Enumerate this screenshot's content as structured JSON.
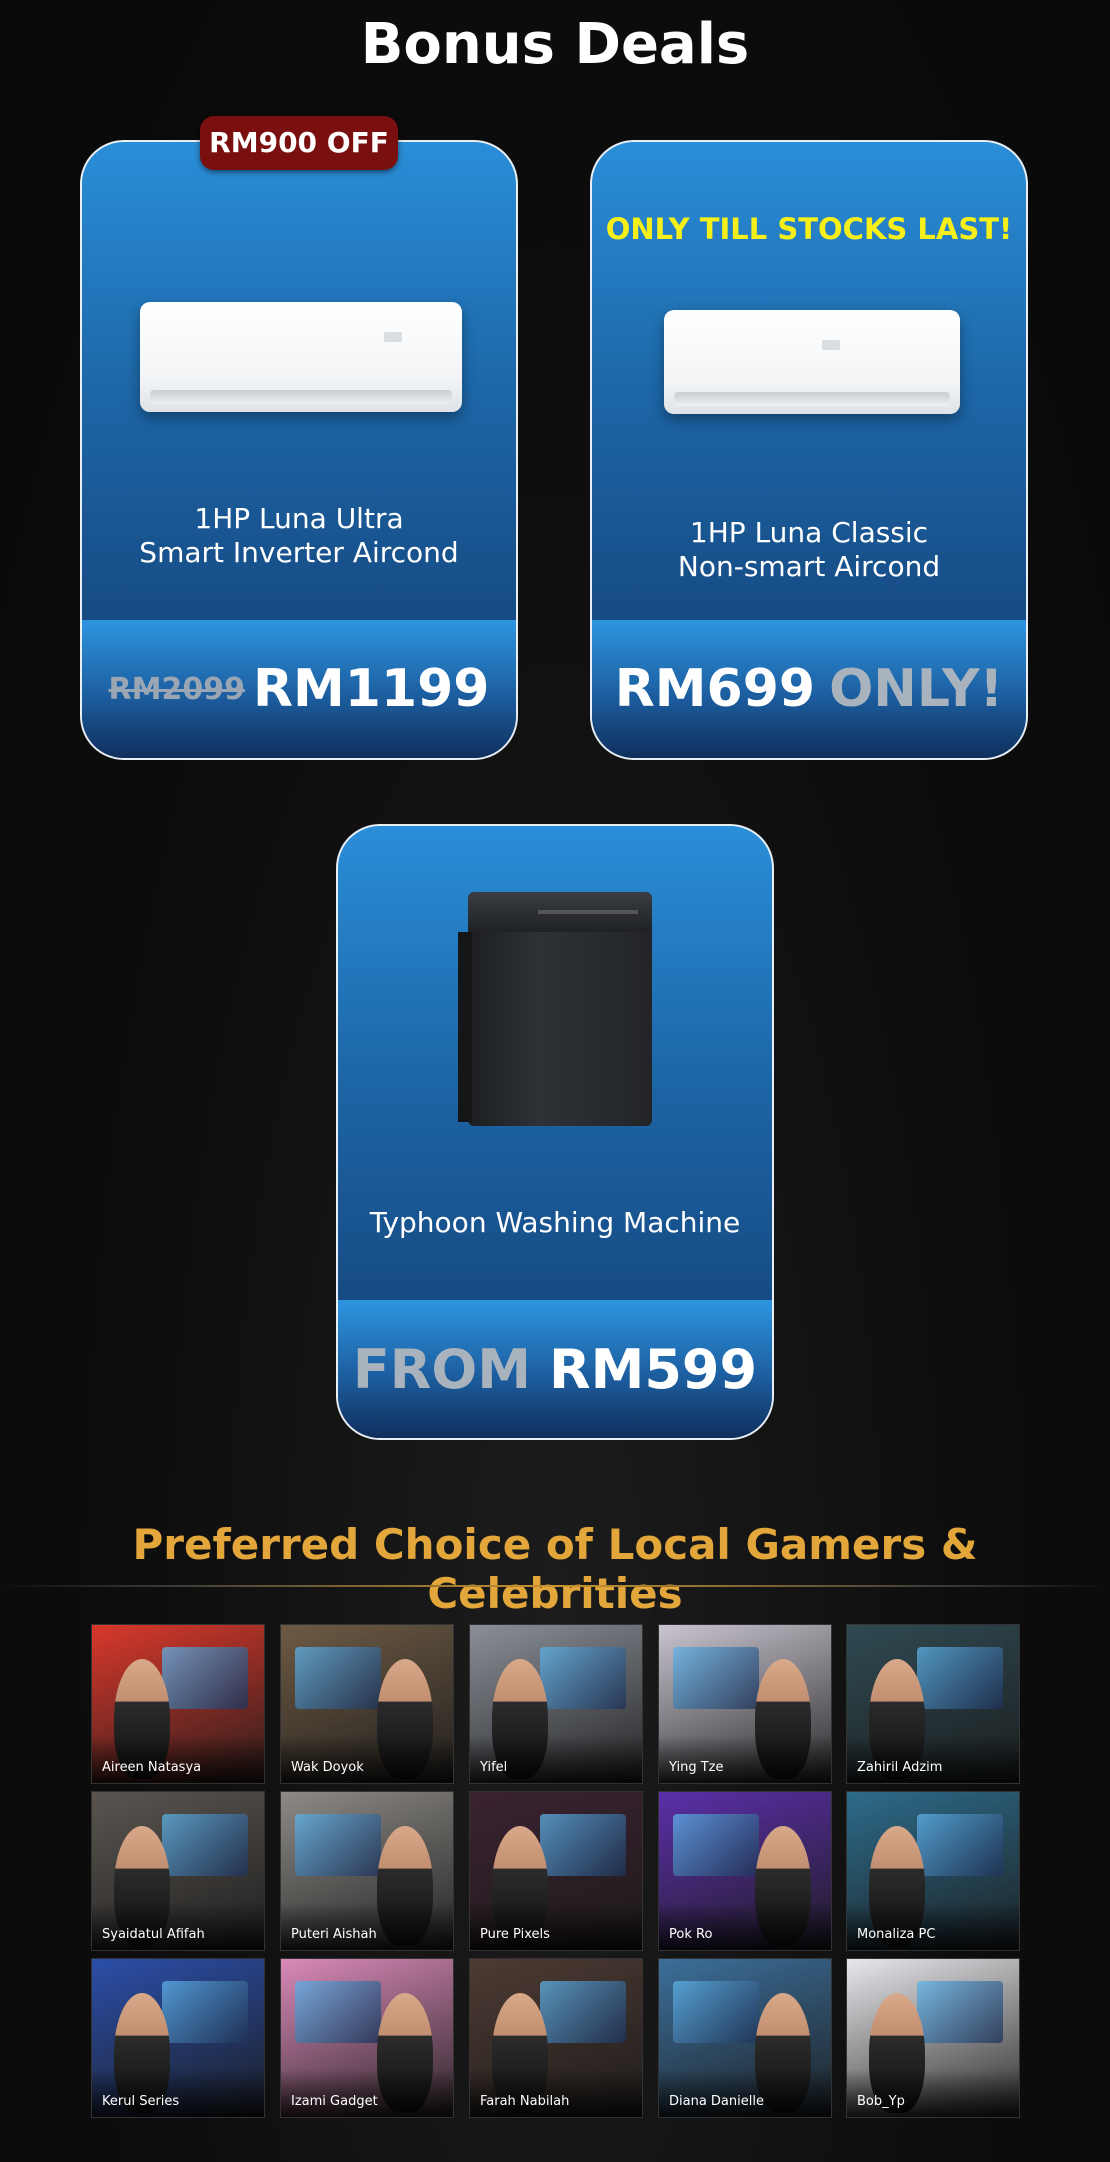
{
  "header": {
    "title": "Bonus Deals"
  },
  "deals": [
    {
      "badge": "RM900 OFF",
      "name_line1": "1HP Luna Ultra",
      "name_line2": "Smart Inverter Aircond",
      "old_price": "RM2099",
      "price": "RM1199"
    },
    {
      "ribbon": "ONLY TILL STOCKS LAST!",
      "name_line1": "1HP Luna Classic",
      "name_line2": "Non-smart Aircond",
      "price": "RM699",
      "price_suffix": "ONLY!"
    },
    {
      "name_line1": "Typhoon Washing Machine",
      "price_prefix": "FROM",
      "price": "RM599"
    }
  ],
  "celebrities": {
    "title": "Preferred Choice of Local Gamers & Celebrities",
    "items": [
      {
        "name": "Aireen Natasya",
        "bg": "#d9382b"
      },
      {
        "name": "Wak Doyok",
        "bg": "#6d5a44"
      },
      {
        "name": "Yifel",
        "bg": "#8a8f97"
      },
      {
        "name": "Ying Tze",
        "bg": "#c9c4cf"
      },
      {
        "name": "Zahiril Adzim",
        "bg": "#2f4a52"
      },
      {
        "name": "Syaidatul Afifah",
        "bg": "#5a5550"
      },
      {
        "name": "Puteri Aishah",
        "bg": "#8d8a86"
      },
      {
        "name": "Pure Pixels",
        "bg": "#3b2230"
      },
      {
        "name": "Pok Ro",
        "bg": "#5b2fa8"
      },
      {
        "name": "Monaliza PC",
        "bg": "#2d6b8a"
      },
      {
        "name": "Kerul Series",
        "bg": "#2b4ea8"
      },
      {
        "name": "Izami Gadget",
        "bg": "#d98ab8"
      },
      {
        "name": "Farah Nabilah",
        "bg": "#4d3a33"
      },
      {
        "name": "Diana Danielle",
        "bg": "#3c6f9a"
      },
      {
        "name": "Bob_Yp",
        "bg": "#e8e8ec"
      }
    ]
  }
}
